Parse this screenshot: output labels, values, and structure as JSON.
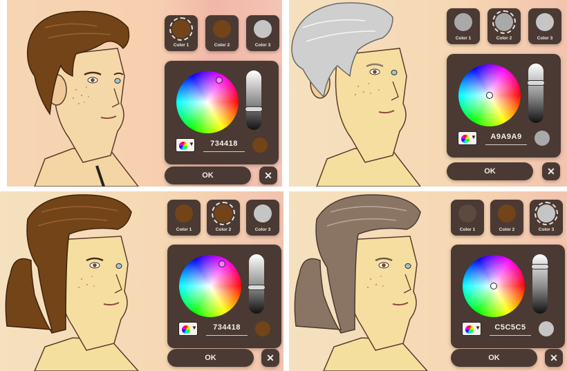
{
  "panels": [
    {
      "swatches": [
        {
          "label": "Color 1",
          "color": "#734418",
          "selected": true
        },
        {
          "label": "Color 2",
          "color": "#734418",
          "selected": false
        },
        {
          "label": "Color 3",
          "color": "#C5C5C5",
          "selected": false
        }
      ],
      "hex": "734418",
      "preview_color": "#734418",
      "hair_color": "#734418",
      "ok_label": "OK",
      "close_label": "✕",
      "hue_saturation_position": "upper-right",
      "brightness_level": 0.45
    },
    {
      "swatches": [
        {
          "label": "Color 1",
          "color": "#A9A9A9",
          "selected": false
        },
        {
          "label": "Color 2",
          "color": "#A9A9A9",
          "selected": true
        },
        {
          "label": "Color 3",
          "color": "#C5C5C5",
          "selected": false
        }
      ],
      "hex": "A9A9A9",
      "preview_color": "#A9A9A9",
      "hair_color": "#A9A9A9",
      "ok_label": "OK",
      "close_label": "✕",
      "hue_saturation_position": "center",
      "brightness_level": 0.7
    },
    {
      "swatches": [
        {
          "label": "Color 1",
          "color": "#734418",
          "selected": false
        },
        {
          "label": "Color 2",
          "color": "#734418",
          "selected": true
        },
        {
          "label": "Color 3",
          "color": "#C5C5C5",
          "selected": false
        }
      ],
      "hex": "734418",
      "preview_color": "#734418",
      "hair_color": "#734418",
      "ok_label": "OK",
      "close_label": "✕",
      "hue_saturation_position": "upper-right",
      "brightness_level": 0.45
    },
    {
      "swatches": [
        {
          "label": "Color 1",
          "color": "#5C4A3E",
          "selected": false
        },
        {
          "label": "Color 2",
          "color": "#734418",
          "selected": false
        },
        {
          "label": "Color 3",
          "color": "#C5C5C5",
          "selected": true
        }
      ],
      "hex": "C5C5C5",
      "preview_color": "#C5C5C5",
      "hair_color": "#8A7565",
      "ok_label": "OK",
      "close_label": "✕",
      "hue_saturation_position": "center",
      "brightness_level": 0.8
    }
  ]
}
